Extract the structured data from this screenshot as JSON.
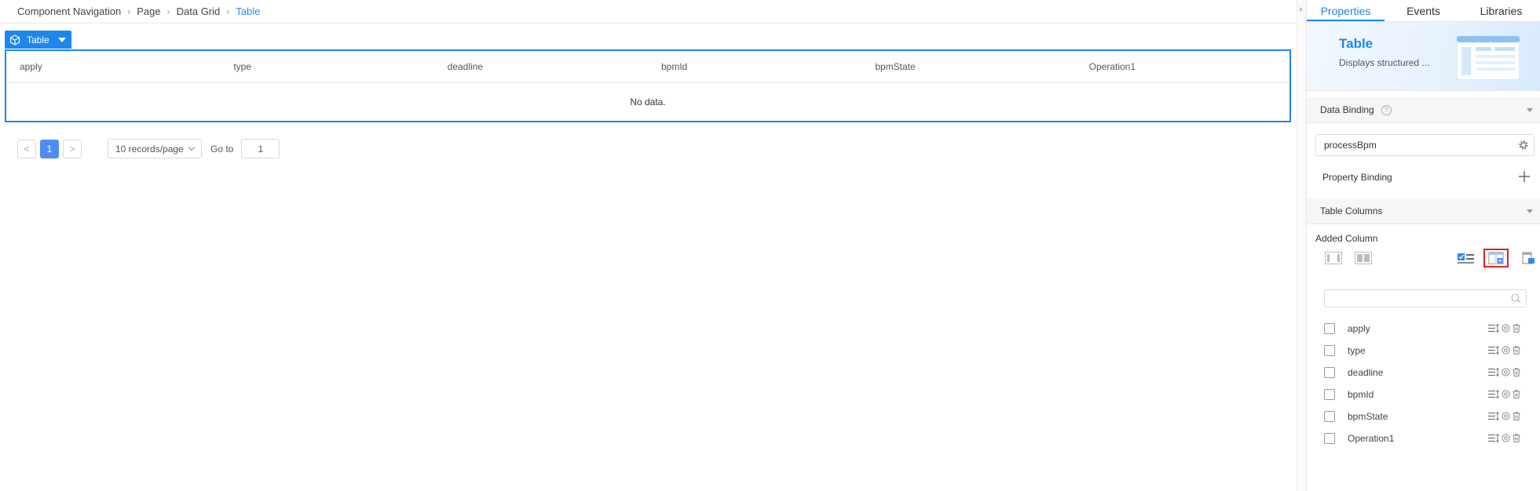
{
  "breadcrumb": {
    "items": [
      "Component Navigation",
      "Page",
      "Data Grid",
      "Table"
    ]
  },
  "component_tag": {
    "label": "Table"
  },
  "grid": {
    "columns": [
      "apply",
      "type",
      "deadline",
      "bpmId",
      "bpmState",
      "Operation1"
    ],
    "empty_text": "No data."
  },
  "pager": {
    "prev": "<",
    "current_page": "1",
    "next": ">",
    "page_size": "10 records/page",
    "goto_label": "Go to",
    "goto_value": "1"
  },
  "panel": {
    "tabs": [
      "Properties",
      "Events",
      "Libraries"
    ],
    "active_tab": "Properties",
    "hero": {
      "title": "Table",
      "description": "Displays structured ..."
    },
    "data_binding": {
      "section_title": "Data Binding",
      "help_icon": "?",
      "value": "processBpm",
      "property_binding_label": "Property Binding"
    },
    "table_columns": {
      "section_title": "Table Columns",
      "added_label": "Added Column",
      "search_placeholder": "",
      "items": [
        "apply",
        "type",
        "deadline",
        "bpmId",
        "bpmState",
        "Operation1"
      ]
    }
  },
  "colors": {
    "accent": "#1d87f0",
    "pager_active": "#4e8cf4",
    "highlight_box": "#e02020"
  },
  "icons": {
    "tag": "cube-icon",
    "gear": "gear-icon",
    "plus": "plus-icon",
    "search": "search-icon",
    "row": [
      "reorder-icon",
      "settings-circle-icon",
      "trash-icon"
    ]
  }
}
